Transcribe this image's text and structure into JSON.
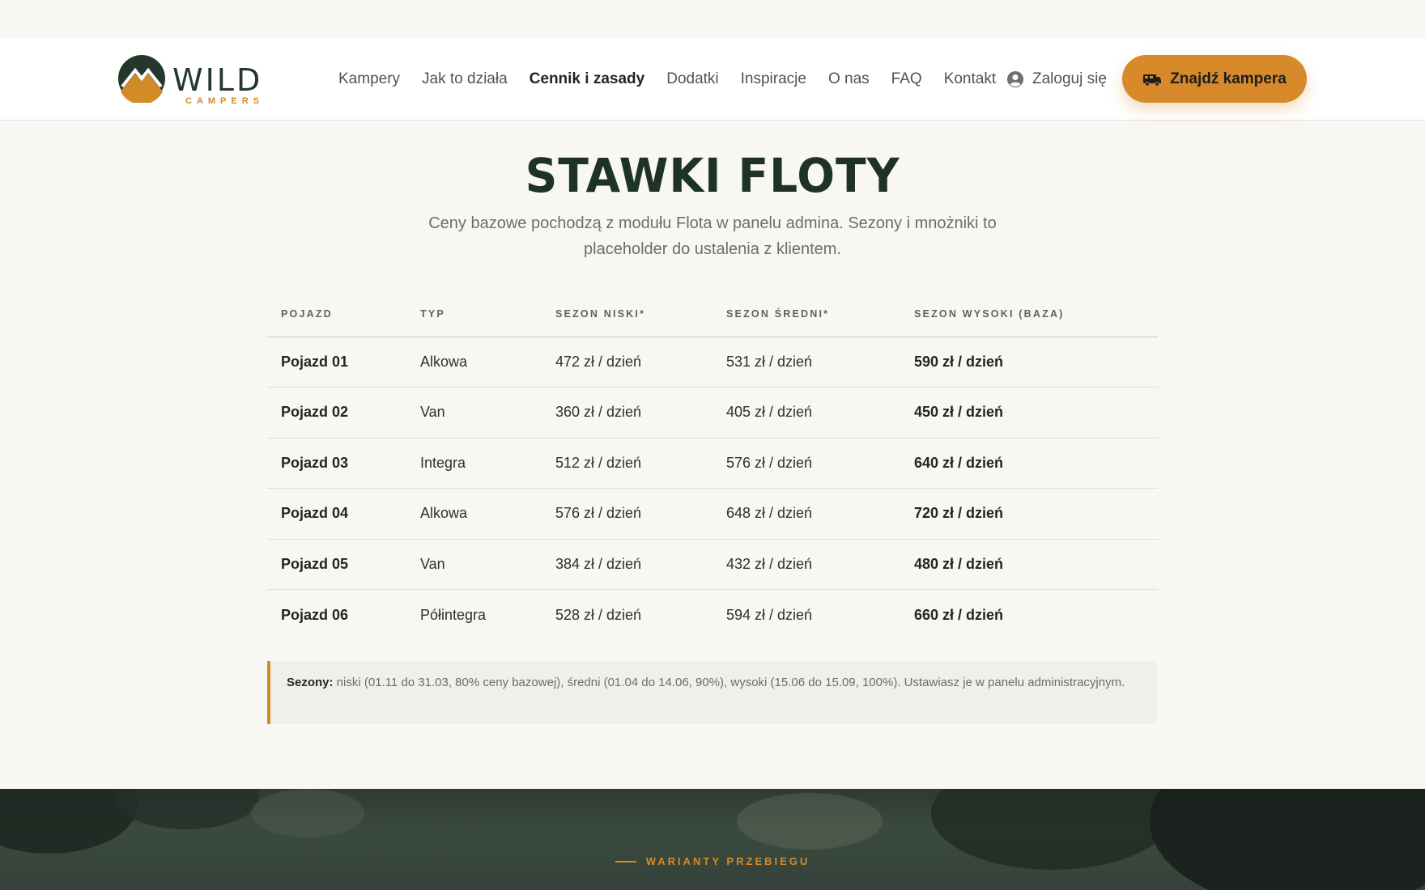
{
  "brand": {
    "name": "WILD",
    "tagline": "CAMPERS",
    "accent": "#d38b27",
    "dark": "#23382b"
  },
  "nav": {
    "items": [
      {
        "label": "Kampery",
        "active": false
      },
      {
        "label": "Jak to działa",
        "active": false
      },
      {
        "label": "Cennik i zasady",
        "active": true
      },
      {
        "label": "Dodatki",
        "active": false
      },
      {
        "label": "Inspiracje",
        "active": false
      },
      {
        "label": "O nas",
        "active": false
      },
      {
        "label": "FAQ",
        "active": false
      },
      {
        "label": "Kontakt",
        "active": false
      }
    ],
    "login_label": "Zaloguj się",
    "cta_label": "Znajdź kampera"
  },
  "section": {
    "title": "STAWKI FLOTY",
    "subtitle": "Ceny bazowe pochodzą z modułu Flota w panelu admina. Sezony i mnożniki to placeholder do ustalenia z klientem."
  },
  "table": {
    "headers": [
      "POJAZD",
      "TYP",
      "SEZON NISKI*",
      "SEZON ŚREDNI*",
      "SEZON WYSOKI (BAZA)"
    ],
    "rows": [
      [
        "Pojazd 01",
        "Alkowa",
        "472 zł / dzień",
        "531 zł / dzień",
        "590 zł / dzień"
      ],
      [
        "Pojazd 02",
        "Van",
        "360 zł / dzień",
        "405 zł / dzień",
        "450 zł / dzień"
      ],
      [
        "Pojazd 03",
        "Integra",
        "512 zł / dzień",
        "576 zł / dzień",
        "640 zł / dzień"
      ],
      [
        "Pojazd 04",
        "Alkowa",
        "576 zł / dzień",
        "648 zł / dzień",
        "720 zł / dzień"
      ],
      [
        "Pojazd 05",
        "Van",
        "384 zł / dzień",
        "432 zł / dzień",
        "480 zł / dzień"
      ],
      [
        "Pojazd 06",
        "Półintegra",
        "528 zł / dzień",
        "594 zł / dzień",
        "660 zł / dzień"
      ]
    ]
  },
  "note": {
    "label": "Sezony:",
    "text": " niski (01.11 do 31.03, 80% ceny bazowej), średni (01.04 do 14.06, 90%), wysoki (15.06 do 15.09, 100%). Ustawiasz je w panelu administracyjnym."
  },
  "next_section": {
    "eyebrow": "WARIANTY PRZEBIEGU"
  }
}
